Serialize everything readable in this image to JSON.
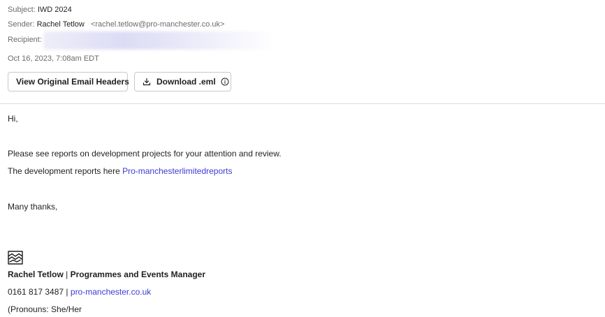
{
  "email": {
    "subject_label": "Subject:",
    "subject": "IWD 2024",
    "sender_label": "Sender:",
    "sender_name": "Rachel Tetlow",
    "sender_email": "<rachel.tetlow@pro-manchester.co.uk>",
    "recipient_label": "Recipient:",
    "date": "Oct 16, 2023, 7:08am EDT"
  },
  "toolbar": {
    "view_headers_label": "View Original Email Headers",
    "download_label": "Download .eml"
  },
  "body": {
    "greeting": "Hi,",
    "line1": "Please see reports on development projects for your attention and review.",
    "line2_prefix": "The development reports here ",
    "line2_link": "Pro-manchesterlimitedreports",
    "signoff": "Many thanks,"
  },
  "signature": {
    "name": "Rachel Tetlow",
    "separator": " | ",
    "title": "Programmes and Events Manager",
    "phone": "0161 817 3487",
    "phone_separator": " | ",
    "website": "pro-manchester.co.uk",
    "pronouns": "(Pronouns: She/Her"
  },
  "icons": {
    "download": "download-icon",
    "info": "info-icon",
    "logo": "company-logo-icon"
  },
  "colors": {
    "link": "#3b3bd6",
    "meta_label": "#6b6b6b",
    "text": "#1f1f1f"
  }
}
